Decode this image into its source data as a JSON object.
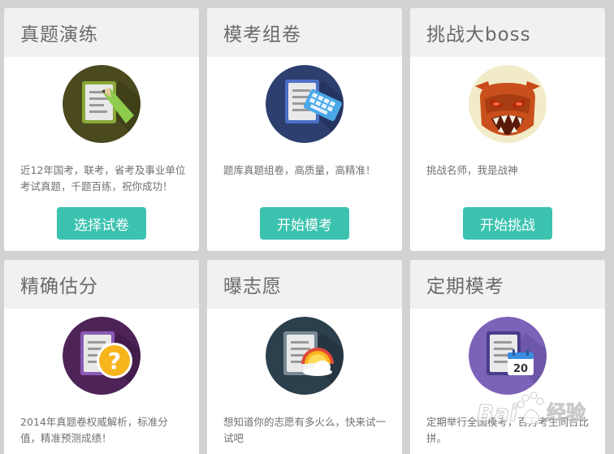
{
  "cards": [
    {
      "title": "真题演练",
      "icon": "exam-paper-pencil-icon",
      "description": "近12年国考，联考，省考及事业单位考试真题，千题百练，祝你成功！",
      "button": "选择试卷"
    },
    {
      "title": "模考组卷",
      "icon": "exam-paper-keyboard-icon",
      "description": "题库真题组卷，高质量，高精准！",
      "button": "开始模考"
    },
    {
      "title": "挑战大boss",
      "icon": "boss-monster-icon",
      "description": "挑战名师，我是战神",
      "button": "开始挑战"
    },
    {
      "title": "精确估分",
      "icon": "exam-paper-question-icon",
      "description": "2014年真题卷权威解析，标准分值，精准预测成绩！"
    },
    {
      "title": "曝志愿",
      "icon": "exam-paper-weather-icon",
      "description": "想知道你的志愿有多火么，快来试一试吧"
    },
    {
      "title": "定期模考",
      "icon": "exam-paper-calendar-icon",
      "calendar_day": "20",
      "description": "定期举行全国模考，百万考生同台比拼。"
    }
  ],
  "watermark": {
    "text": "Bai",
    "text2": "经验"
  },
  "colors": {
    "background": "#d2d2d2",
    "card": "#ffffff",
    "card_header": "#f1f1f1",
    "button": "#3cc3b0",
    "title_text": "#6a6a6a",
    "body_text": "#707070"
  }
}
